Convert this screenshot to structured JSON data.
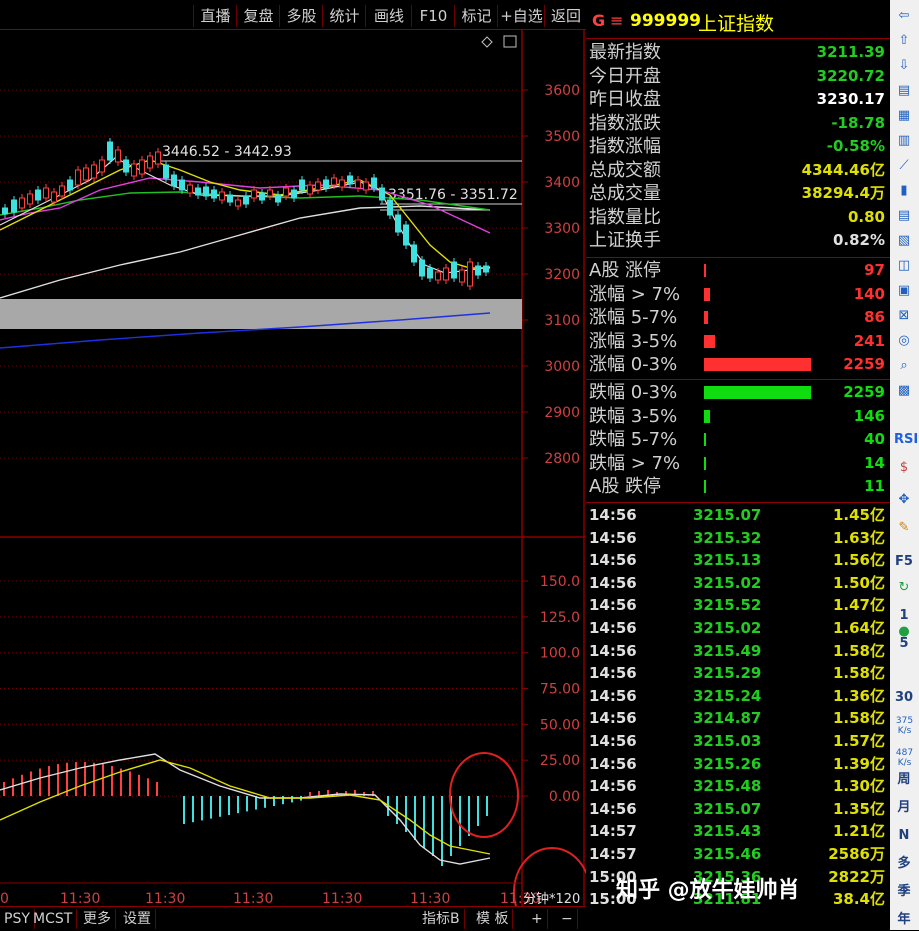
{
  "toolbar": {
    "buttons": [
      "直播",
      "复盘",
      "多股",
      "统计",
      "画线",
      "F10",
      "标记",
      "+自选",
      "返回"
    ]
  },
  "chart": {
    "price_axis": [
      "3600",
      "3500",
      "3400",
      "3300",
      "3200",
      "3100",
      "3000",
      "2900",
      "2800"
    ],
    "indicator_axis": [
      "150.0",
      "125.0",
      "100.0",
      "75.00",
      "50.00",
      "25.00",
      "0.00"
    ],
    "time_labels": [
      "0",
      "11:30",
      "11:30",
      "11:30",
      "11:30",
      "11:30",
      "11:30",
      "11:30"
    ],
    "annotation_high": "3446.52 - 3442.93",
    "annotation_mid": "3351.76 - 3351.72",
    "period_label": "分钟*120",
    "colors": {
      "bull": "#ff4040",
      "bear": "#40e0e0",
      "ma_white": "#e0e0e0",
      "ma_yellow": "#e0e000",
      "ma_magenta": "#e040e0",
      "ma_green": "#20c020",
      "ma_blue": "#2030e0"
    }
  },
  "quote": {
    "code": "999999",
    "name": "上证指数",
    "rows": [
      {
        "label": "最新指数",
        "value": "3211.39",
        "color": "#22cc22"
      },
      {
        "label": "今日开盘",
        "value": "3220.72",
        "color": "#22cc22"
      },
      {
        "label": "昨日收盘",
        "value": "3230.17",
        "color": "#ffffff"
      },
      {
        "label": "指数涨跌",
        "value": "-18.78",
        "color": "#22cc22"
      },
      {
        "label": "指数涨幅",
        "value": "-0.58%",
        "color": "#22cc22"
      },
      {
        "label": "总成交额",
        "value": "4344.46亿",
        "color": "#e0e000"
      },
      {
        "label": "总成交量",
        "value": "38294.4万",
        "color": "#e0e000"
      },
      {
        "label": "指数量比",
        "value": "0.80",
        "color": "#e0e000"
      },
      {
        "label": "上证换手",
        "value": "0.82%",
        "color": "#e0e0e0"
      }
    ],
    "breadth_up": [
      {
        "label": "A股 涨停",
        "value": "97",
        "fraction": 0.02
      },
      {
        "label": "涨幅 > 7%",
        "value": "140",
        "fraction": 0.06
      },
      {
        "label": "涨幅 5-7%",
        "value": "86",
        "fraction": 0.04
      },
      {
        "label": "涨幅 3-5%",
        "value": "241",
        "fraction": 0.1
      },
      {
        "label": "涨幅 0-3%",
        "value": "2259",
        "fraction": 1.0
      }
    ],
    "breadth_down": [
      {
        "label": "跌幅 0-3%",
        "value": "2259",
        "fraction": 1.0
      },
      {
        "label": "跌幅 3-5%",
        "value": "146",
        "fraction": 0.06
      },
      {
        "label": "跌幅 5-7%",
        "value": "40",
        "fraction": 0.01
      },
      {
        "label": "跌幅 > 7%",
        "value": "14",
        "fraction": 0.01
      },
      {
        "label": "A股 跌停",
        "value": "11",
        "fraction": 0.01
      }
    ],
    "up_color": "#ff3030",
    "down_color": "#10dd10",
    "ticks": [
      {
        "time": "14:56",
        "price": "3215.07",
        "vol": "1.45亿"
      },
      {
        "time": "14:56",
        "price": "3215.32",
        "vol": "1.63亿"
      },
      {
        "time": "14:56",
        "price": "3215.13",
        "vol": "1.56亿"
      },
      {
        "time": "14:56",
        "price": "3215.02",
        "vol": "1.50亿"
      },
      {
        "time": "14:56",
        "price": "3215.52",
        "vol": "1.47亿"
      },
      {
        "time": "14:56",
        "price": "3215.02",
        "vol": "1.64亿"
      },
      {
        "time": "14:56",
        "price": "3215.49",
        "vol": "1.58亿"
      },
      {
        "time": "14:56",
        "price": "3215.29",
        "vol": "1.58亿"
      },
      {
        "time": "14:56",
        "price": "3215.24",
        "vol": "1.36亿"
      },
      {
        "time": "14:56",
        "price": "3214.87",
        "vol": "1.58亿"
      },
      {
        "time": "14:56",
        "price": "3215.03",
        "vol": "1.57亿"
      },
      {
        "time": "14:56",
        "price": "3215.26",
        "vol": "1.39亿"
      },
      {
        "time": "14:56",
        "price": "3215.48",
        "vol": "1.30亿"
      },
      {
        "time": "14:56",
        "price": "3215.07",
        "vol": "1.35亿"
      },
      {
        "time": "14:57",
        "price": "3215.43",
        "vol": "1.21亿"
      },
      {
        "time": "14:57",
        "price": "3215.46",
        "vol": "2586万"
      },
      {
        "time": "15:00",
        "price": "3215.36",
        "vol": "2822万"
      },
      {
        "time": "15:00",
        "price": "3211.81",
        "vol": "38.4亿"
      }
    ]
  },
  "bottom": {
    "tabs": [
      "PSY",
      "MCST",
      "更多",
      "设置"
    ],
    "right_tabs": [
      "指标B",
      "模 板",
      "+",
      "−"
    ]
  },
  "side": {
    "labels": [
      "RSI",
      "F5",
      "1",
      "5",
      "30",
      "周",
      "月",
      "N",
      "多",
      "季",
      "年"
    ],
    "rate1": "375 K/s",
    "rate2": "487 K/s"
  },
  "watermark": "知乎 @放牛娃帅肖"
}
